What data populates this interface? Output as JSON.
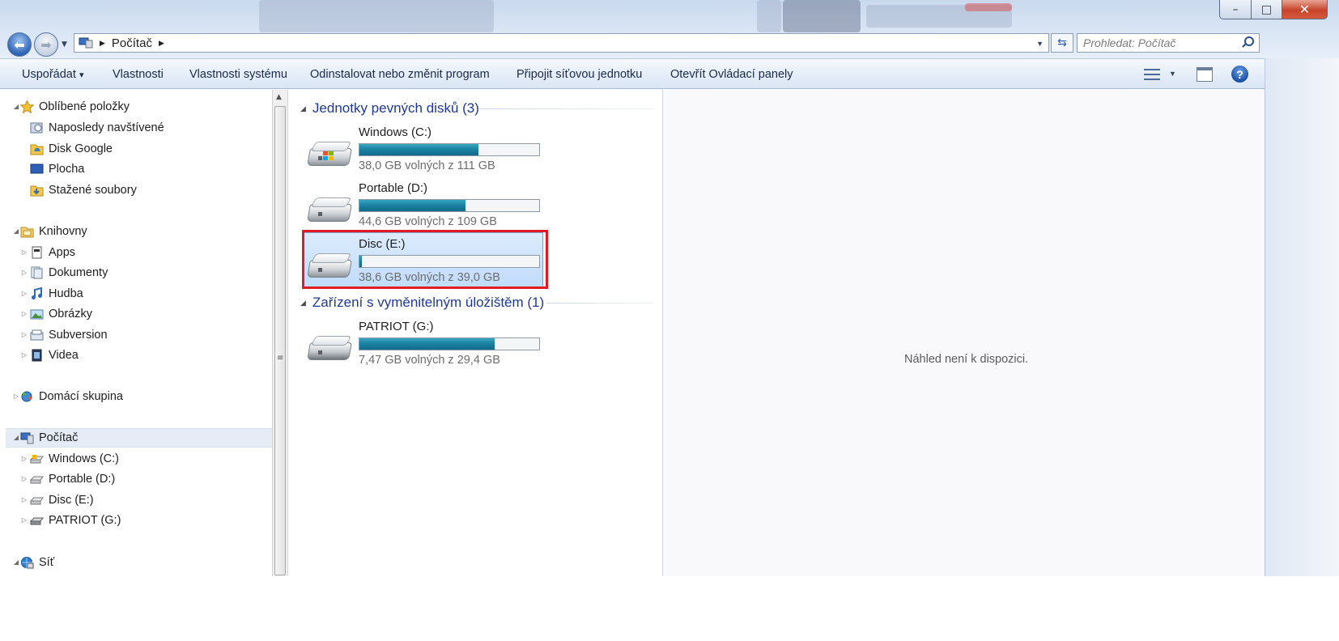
{
  "window": {
    "address_segments": [
      "Počítač"
    ],
    "search_placeholder": "Prohledat: Počítač",
    "controls": {
      "minimize": "–",
      "maximize": "□",
      "close": "✕"
    }
  },
  "toolbar": {
    "items": [
      "Uspořádat",
      "Vlastnosti",
      "Vlastnosti systému",
      "Odinstalovat nebo změnit program",
      "Připojit síťovou jednotku",
      "Otevřít Ovládací panely"
    ],
    "organize_arrow": "▾",
    "help_label": "?"
  },
  "nav": {
    "favorites": {
      "label": "Oblíbené položky",
      "items": [
        "Naposledy navštívené",
        "Disk Google",
        "Plocha",
        "Stažené soubory"
      ]
    },
    "libraries": {
      "label": "Knihovny",
      "items": [
        "Apps",
        "Dokumenty",
        "Hudba",
        "Obrázky",
        "Subversion",
        "Videa"
      ]
    },
    "homegroup": {
      "label": "Domácí skupina"
    },
    "computer": {
      "label": "Počítač",
      "items": [
        "Windows (C:)",
        "Portable (D:)",
        "Disc (E:)",
        "PATRIOT (G:)"
      ]
    },
    "network": {
      "label": "Síť"
    }
  },
  "content": {
    "groups": [
      {
        "title": "Jednotky pevných disků (3)",
        "drives": [
          {
            "name": "Windows (C:)",
            "info": "38,0 GB volných z 111 GB",
            "used_fraction": 0.66
          },
          {
            "name": "Portable (D:)",
            "info": "44,6 GB volných z 109 GB",
            "used_fraction": 0.59
          },
          {
            "name": "Disc (E:)",
            "info": "38,6 GB volných z 39,0 GB",
            "used_fraction": 0.01
          }
        ]
      },
      {
        "title": "Zařízení s vyměnitelným úložištěm (1)",
        "drives": [
          {
            "name": "PATRIOT (G:)",
            "info": "7,47 GB volných z 29,4 GB",
            "used_fraction": 0.75
          }
        ]
      }
    ]
  },
  "preview": {
    "message": "Náhled není k dispozici."
  },
  "colors": {
    "highlight_border": "#e01b24",
    "bar_fill": "#1b7fa0",
    "group_title": "#1e3a96"
  }
}
